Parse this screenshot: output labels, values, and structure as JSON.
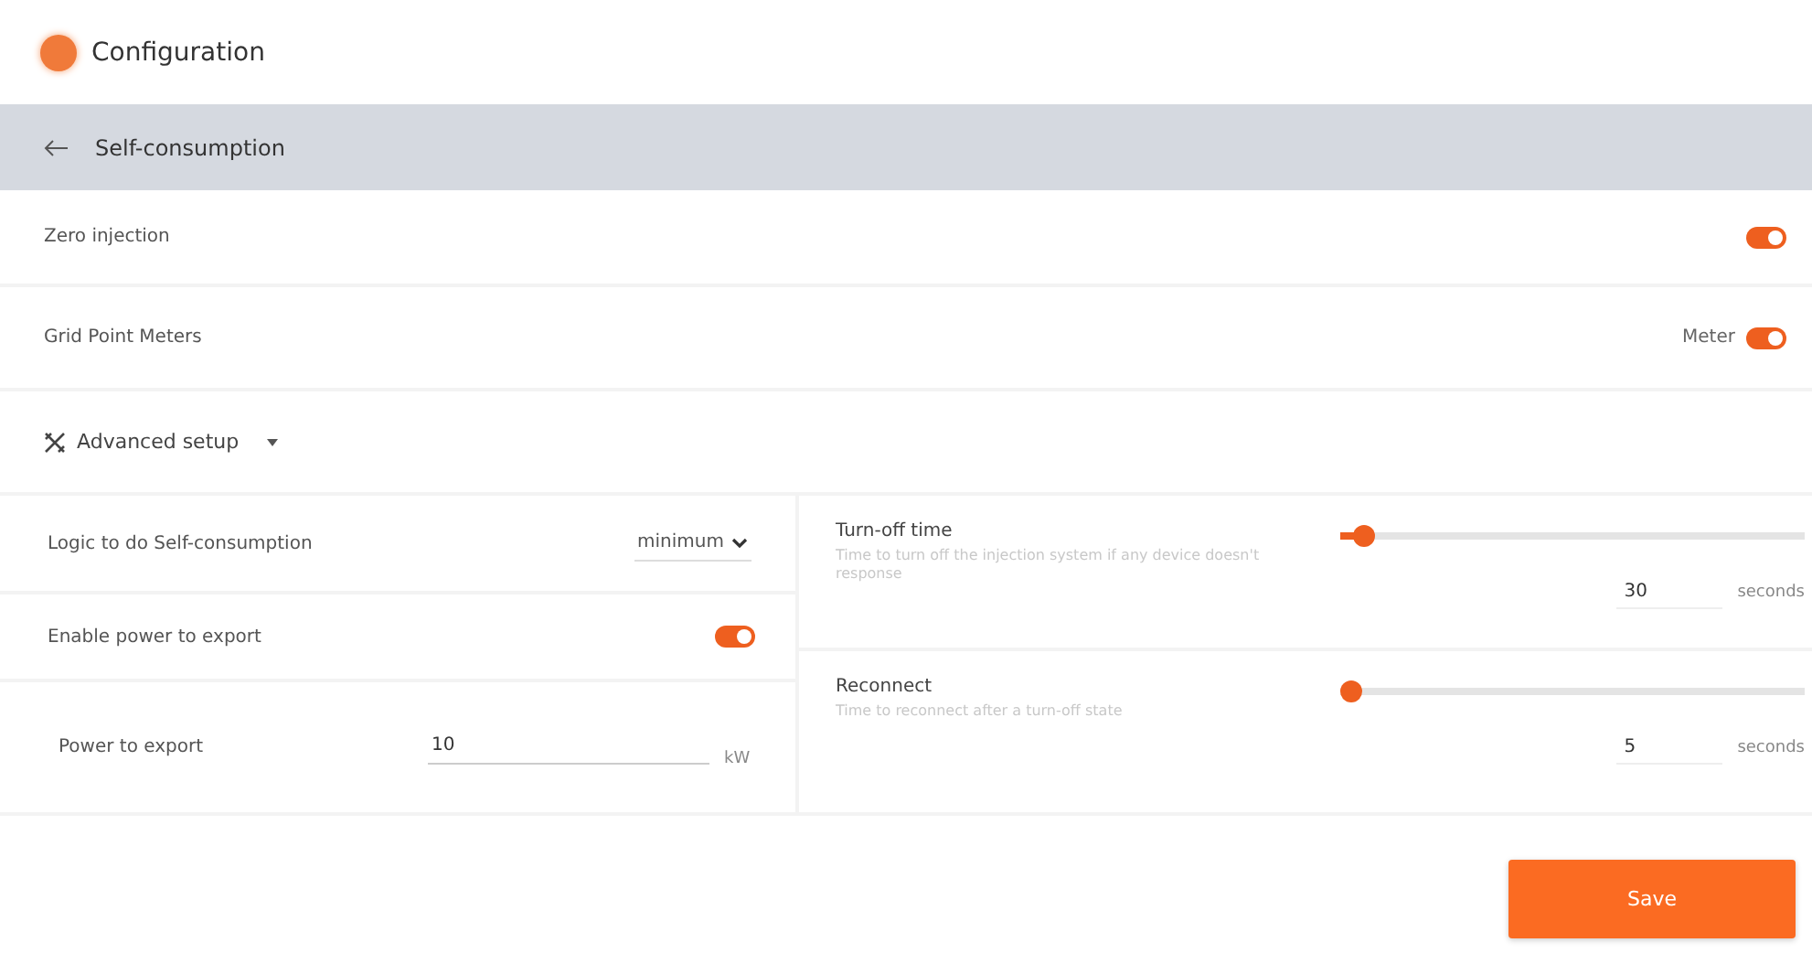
{
  "header": {
    "title": "Configuration"
  },
  "subheader": {
    "title": "Self-consumption"
  },
  "settings": [
    {
      "label": "Zero injection",
      "on": true
    },
    {
      "label": "Grid Point Meters",
      "value_label": "Meter",
      "on": true
    }
  ],
  "advanced": {
    "label": "Advanced setup",
    "expanded": true
  },
  "left": [
    {
      "kind": "select",
      "label": "Logic to do Self-consumption",
      "value": "minimum"
    },
    {
      "kind": "toggle",
      "label": "Enable power to export",
      "on": true
    },
    {
      "kind": "input",
      "label": "Power to export",
      "value": "10",
      "unit": "kW"
    }
  ],
  "right": [
    {
      "label": "Turn-off time",
      "description": "Time to turn off the injection system if any device doesn't response",
      "level": 0.03,
      "value": "30",
      "unit": "seconds"
    },
    {
      "label": "Reconnect",
      "description": "Time to reconnect after a turn-off state",
      "level": 0,
      "value": "5",
      "unit": "seconds"
    }
  ],
  "save_button": "Save"
}
